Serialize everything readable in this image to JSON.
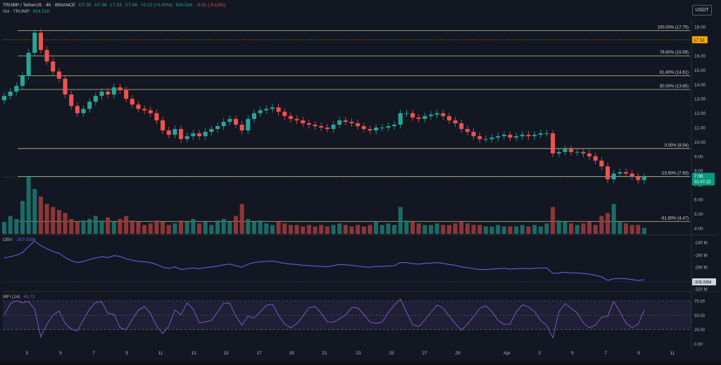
{
  "header": {
    "symbol": "TRUMP / TetherUS · 4h · BINANCE",
    "open": "O7.35",
    "high": "H7.56",
    "low": "L7.33",
    "close": "C7.56",
    "change": "+0.22 (+3.00%)",
    "vol_val": "924.51K",
    "change2": "-0.01 (-0.13%)",
    "vol_label": "Vol · TRUMP",
    "vol_value": "924.51K",
    "currency": "USDT"
  },
  "price_badges": {
    "mid": "17.11",
    "last": "7.56",
    "countdown": "01:47:13"
  },
  "fib_levels": [
    {
      "label": "100.00% (17.75)",
      "price": 17.75
    },
    {
      "label": "78.60% (15.99)",
      "price": 15.99
    },
    {
      "label": "61.80% (14.61)",
      "price": 14.61
    },
    {
      "label": "50.00% (13.65)",
      "price": 13.65
    },
    {
      "label": "0.00% (9.54)",
      "price": 9.54
    },
    {
      "label": "-23.60% (7.60)",
      "price": 7.6
    },
    {
      "label": "-61.80% (4.47)",
      "price": 4.47
    }
  ],
  "obv": {
    "label": "OBV",
    "value": "-307.53M",
    "axis": [
      "-240 M",
      "-260 M",
      "-280 M",
      "-306.59M",
      "-320 M"
    ],
    "last": "-306.59M"
  },
  "mfi": {
    "label": "MFI (14)",
    "value": "45.72",
    "axis": [
      "75.00",
      "50.00",
      "25.00",
      "0.00"
    ]
  },
  "chart_data": [
    {
      "type": "candlestick",
      "title": "TRUMP / TetherUS · 4h · BINANCE",
      "ylim": [
        3.6,
        18.6
      ],
      "y_ticks": [
        "18.00",
        "17.00",
        "16.00",
        "15.00",
        "14.00",
        "13.00",
        "12.00",
        "11.00",
        "10.00",
        "9.00",
        "8.00",
        "7.00",
        "6.00",
        "5.00",
        "4.00"
      ],
      "x_ticks": [
        "3",
        "5",
        "7",
        "9",
        "11",
        "13",
        "15",
        "17",
        "19",
        "21",
        "23",
        "25",
        "27",
        "29",
        "Apr",
        "3",
        "5",
        "7",
        "9",
        "11"
      ],
      "close_path": [
        13.2,
        13.5,
        13.9,
        14.6,
        16.2,
        17.6,
        16.4,
        15.6,
        14.9,
        14.4,
        13.3,
        12.5,
        12.0,
        12.3,
        12.8,
        13.2,
        13.5,
        13.3,
        13.8,
        13.6,
        13.0,
        12.6,
        12.3,
        12.2,
        12.0,
        11.5,
        10.8,
        10.5,
        10.9,
        10.2,
        10.4,
        10.6,
        10.4,
        10.7,
        10.9,
        11.1,
        11.4,
        11.6,
        11.2,
        10.8,
        11.6,
        12.0,
        12.2,
        12.3,
        12.4,
        12.1,
        11.8,
        11.6,
        11.5,
        11.3,
        11.2,
        11.1,
        11.0,
        10.9,
        11.2,
        11.5,
        11.4,
        11.3,
        11.1,
        10.9,
        10.8,
        11.0,
        11.0,
        11.1,
        11.2,
        12.0,
        12.0,
        11.7,
        11.6,
        11.8,
        11.9,
        12.0,
        11.8,
        11.5,
        11.3,
        10.9,
        10.7,
        10.4,
        10.2,
        10.2,
        10.3,
        10.4,
        10.5,
        10.3,
        10.4,
        10.5,
        10.4,
        10.5,
        10.6,
        10.6,
        9.2,
        9.3,
        9.5,
        9.3,
        9.3,
        9.2,
        9.0,
        8.7,
        8.3,
        7.4,
        7.8,
        7.9,
        7.8,
        7.6,
        7.35,
        7.56
      ],
      "volume_path": [
        0.8,
        1.2,
        1.0,
        2.2,
        3.8,
        3.0,
        2.5,
        2.0,
        1.8,
        1.6,
        1.4,
        1.0,
        0.8,
        0.9,
        1.0,
        1.2,
        0.9,
        1.1,
        0.8,
        1.0,
        1.2,
        0.9,
        0.8,
        0.6,
        0.7,
        0.9,
        0.8,
        0.6,
        0.7,
        0.9,
        0.8,
        1.0,
        0.7,
        0.8,
        0.6,
        0.9,
        1.0,
        0.8,
        1.2,
        2.0,
        1.0,
        0.8,
        0.9,
        0.7,
        0.6,
        0.8,
        0.7,
        0.6,
        0.6,
        0.5,
        0.6,
        0.5,
        0.6,
        0.5,
        0.6,
        0.7,
        0.6,
        0.5,
        0.6,
        0.5,
        0.6,
        0.8,
        0.6,
        0.7,
        0.6,
        1.8,
        0.9,
        0.8,
        0.7,
        0.6,
        0.6,
        0.7,
        0.6,
        0.6,
        0.7,
        0.8,
        0.7,
        0.6,
        0.6,
        0.5,
        0.5,
        0.6,
        0.5,
        0.5,
        0.5,
        0.6,
        0.5,
        0.6,
        0.5,
        0.7,
        1.8,
        0.9,
        0.8,
        0.7,
        0.6,
        0.7,
        0.8,
        0.6,
        1.2,
        1.4,
        2.0,
        0.8,
        0.7,
        0.6,
        0.6,
        0.4
      ]
    }
  ]
}
